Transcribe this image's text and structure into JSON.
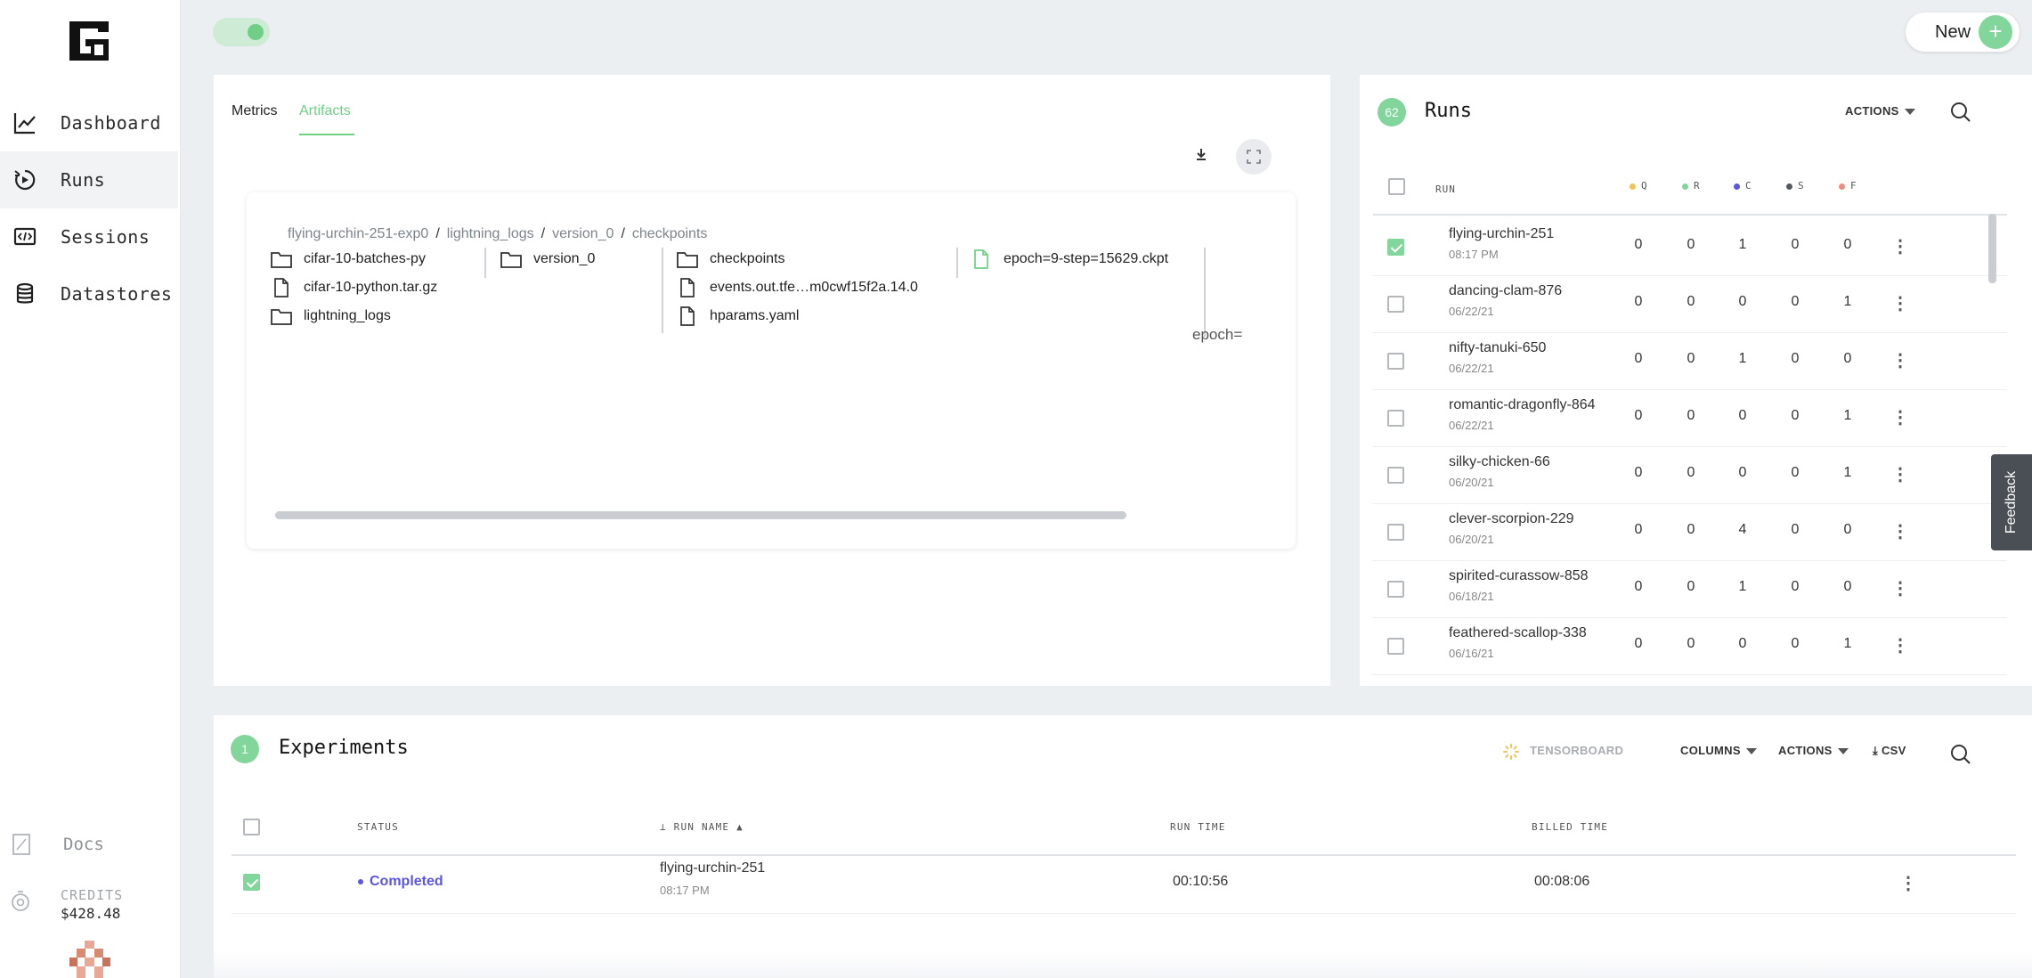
{
  "app": {
    "new_button": "New",
    "new_plus": "+"
  },
  "sidebar": {
    "items": [
      {
        "label": "Dashboard",
        "icon": "chart-line-icon"
      },
      {
        "label": "Runs",
        "icon": "runs-icon"
      },
      {
        "label": "Sessions",
        "icon": "code-monitor-icon"
      },
      {
        "label": "Datastores",
        "icon": "database-icon"
      }
    ],
    "active": "Runs",
    "docs_label": "Docs",
    "credits_label": "CREDITS",
    "credits_value": "$428.48"
  },
  "artifacts_panel": {
    "tabs": [
      {
        "label": "Metrics",
        "active": false
      },
      {
        "label": "Artifacts",
        "active": true
      }
    ],
    "breadcrumb": [
      "flying-urchin-251-exp0",
      "lightning_logs",
      "version_0",
      "checkpoints"
    ],
    "breadcrumb_sep": "/",
    "columns": [
      [
        {
          "name": "cifar-10-batches-py",
          "type": "folder"
        },
        {
          "name": "cifar-10-python.tar.gz",
          "type": "file"
        },
        {
          "name": "lightning_logs",
          "type": "folder"
        }
      ],
      [
        {
          "name": "version_0",
          "type": "folder"
        }
      ],
      [
        {
          "name": "checkpoints",
          "type": "folder"
        },
        {
          "name": "events.out.tfe…m0cwf15f2a.14.0",
          "type": "file"
        },
        {
          "name": "hparams.yaml",
          "type": "file"
        }
      ],
      [
        {
          "name": "epoch=9-step=15629.ckpt",
          "type": "file-selected"
        }
      ]
    ],
    "preview_text": "epoch="
  },
  "runs_panel": {
    "count": "62",
    "title": "Runs",
    "actions_label": "ACTIONS",
    "columns": {
      "run": "RUN",
      "statuses": [
        {
          "label": "Q",
          "color": "#f2c35b"
        },
        {
          "label": "R",
          "color": "#83d69b"
        },
        {
          "label": "C",
          "color": "#5c55e0"
        },
        {
          "label": "S",
          "color": "#555a60"
        },
        {
          "label": "F",
          "color": "#f08b7a"
        }
      ]
    },
    "rows": [
      {
        "name": "flying-urchin-251",
        "date": "08:17 PM",
        "q": "0",
        "r": "0",
        "c": "1",
        "s": "0",
        "f": "0",
        "checked": true
      },
      {
        "name": "dancing-clam-876",
        "date": "06/22/21",
        "q": "0",
        "r": "0",
        "c": "0",
        "s": "0",
        "f": "1",
        "checked": false
      },
      {
        "name": "nifty-tanuki-650",
        "date": "06/22/21",
        "q": "0",
        "r": "0",
        "c": "1",
        "s": "0",
        "f": "0",
        "checked": false
      },
      {
        "name": "romantic-dragonfly-864",
        "date": "06/22/21",
        "q": "0",
        "r": "0",
        "c": "0",
        "s": "0",
        "f": "1",
        "checked": false
      },
      {
        "name": "silky-chicken-66",
        "date": "06/20/21",
        "q": "0",
        "r": "0",
        "c": "0",
        "s": "0",
        "f": "1",
        "checked": false
      },
      {
        "name": "clever-scorpion-229",
        "date": "06/20/21",
        "q": "0",
        "r": "0",
        "c": "4",
        "s": "0",
        "f": "0",
        "checked": false
      },
      {
        "name": "spirited-curassow-858",
        "date": "06/18/21",
        "q": "0",
        "r": "0",
        "c": "1",
        "s": "0",
        "f": "0",
        "checked": false
      },
      {
        "name": "feathered-scallop-338",
        "date": "06/16/21",
        "q": "0",
        "r": "0",
        "c": "0",
        "s": "0",
        "f": "1",
        "checked": false
      }
    ]
  },
  "feedback_label": "Feedback",
  "experiments_panel": {
    "count": "1",
    "title": "Experiments",
    "toolbar": {
      "tensorboard": "TENSORBOARD",
      "columns": "COLUMNS",
      "actions": "ACTIONS",
      "csv": "CSV"
    },
    "headers": {
      "status": "STATUS",
      "run_name": "RUN NAME",
      "run_time": "RUN TIME",
      "billed_time": "BILLED TIME"
    },
    "rows": [
      {
        "status": "Completed",
        "status_color": "#5c55e0",
        "run_name": "flying-urchin-251",
        "run_sub": "08:17 PM",
        "run_time": "00:10:56",
        "billed_time": "00:08:06",
        "checked": true
      }
    ]
  }
}
